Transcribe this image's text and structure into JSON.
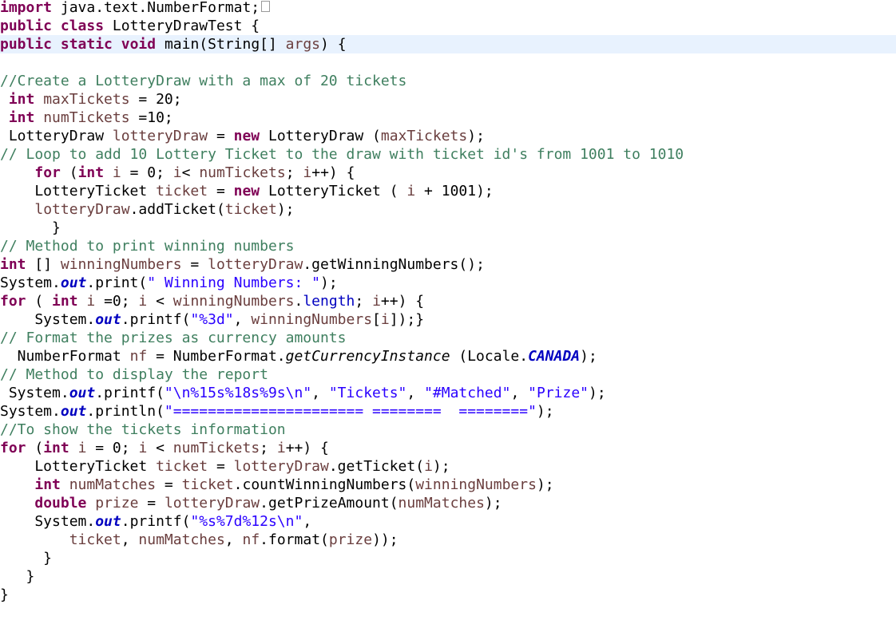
{
  "editor": {
    "current_line": 3,
    "colors": {
      "keyword": "#7f0055",
      "comment": "#3f7f5f",
      "string": "#2a00ff",
      "local_variable": "#6a3e3e",
      "static_field": "#0000c0",
      "current_line_bg": "#e8f2fe"
    },
    "lines": [
      [
        [
          "import",
          "k"
        ],
        [
          " java.text.NumberFormat;",
          "t"
        ],
        [
          "",
          "fold"
        ]
      ],
      [
        [
          "public",
          "k"
        ],
        [
          " ",
          "t"
        ],
        [
          "class",
          "k"
        ],
        [
          " LotteryDrawTest {",
          "t"
        ]
      ],
      [
        [
          "public",
          "k"
        ],
        [
          " ",
          "t"
        ],
        [
          "static",
          "k"
        ],
        [
          " ",
          "t"
        ],
        [
          "void",
          "k"
        ],
        [
          " main(String[] ",
          "t"
        ],
        [
          "args",
          "v"
        ],
        [
          ") {",
          "t"
        ]
      ],
      [],
      [
        [
          "//Create a LotteryDraw with a max of 20 tickets",
          "c"
        ]
      ],
      [
        [
          " ",
          "t"
        ],
        [
          "int",
          "k"
        ],
        [
          " ",
          "t"
        ],
        [
          "maxTickets",
          "v"
        ],
        [
          " = 20;",
          "t"
        ]
      ],
      [
        [
          " ",
          "t"
        ],
        [
          "int",
          "k"
        ],
        [
          " ",
          "t"
        ],
        [
          "numTickets",
          "v"
        ],
        [
          " =10;",
          "t"
        ]
      ],
      [
        [
          " LotteryDraw ",
          "t"
        ],
        [
          "lotteryDraw",
          "v"
        ],
        [
          " = ",
          "t"
        ],
        [
          "new",
          "k"
        ],
        [
          " LotteryDraw (",
          "t"
        ],
        [
          "maxTickets",
          "v"
        ],
        [
          ");",
          "t"
        ]
      ],
      [
        [
          "// Loop to add 10 Lottery Ticket to the draw with ticket id's from 1001 to 1010",
          "c"
        ]
      ],
      [
        [
          "    ",
          "t"
        ],
        [
          "for",
          "k"
        ],
        [
          " (",
          "t"
        ],
        [
          "int",
          "k"
        ],
        [
          " ",
          "t"
        ],
        [
          "i",
          "v"
        ],
        [
          " = 0; ",
          "t"
        ],
        [
          "i",
          "v"
        ],
        [
          "< ",
          "t"
        ],
        [
          "numTickets",
          "v"
        ],
        [
          "; ",
          "t"
        ],
        [
          "i",
          "v"
        ],
        [
          "++) {",
          "t"
        ]
      ],
      [
        [
          "    LotteryTicket ",
          "t"
        ],
        [
          "ticket",
          "v"
        ],
        [
          " = ",
          "t"
        ],
        [
          "new",
          "k"
        ],
        [
          " LotteryTicket ( ",
          "t"
        ],
        [
          "i",
          "v"
        ],
        [
          " + 1001);",
          "t"
        ]
      ],
      [
        [
          "    ",
          "t"
        ],
        [
          "lotteryDraw",
          "v"
        ],
        [
          ".addTicket(",
          "t"
        ],
        [
          "ticket",
          "v"
        ],
        [
          ");",
          "t"
        ]
      ],
      [
        [
          "      }",
          "t"
        ]
      ],
      [
        [
          "// Method to print winning numbers",
          "c"
        ]
      ],
      [
        [
          "int",
          "k"
        ],
        [
          " [] ",
          "t"
        ],
        [
          "winningNumbers",
          "v"
        ],
        [
          " = ",
          "t"
        ],
        [
          "lotteryDraw",
          "v"
        ],
        [
          ".getWinningNumbers();",
          "t"
        ]
      ],
      [
        [
          "System.",
          "t"
        ],
        [
          "out",
          "f"
        ],
        [
          ".print(",
          "t"
        ],
        [
          "\" Winning Numbers: \"",
          "s"
        ],
        [
          ");",
          "t"
        ]
      ],
      [
        [
          "for",
          "k"
        ],
        [
          " ( ",
          "t"
        ],
        [
          "int",
          "k"
        ],
        [
          " ",
          "t"
        ],
        [
          "i",
          "v"
        ],
        [
          " =0; ",
          "t"
        ],
        [
          "i",
          "v"
        ],
        [
          " < ",
          "t"
        ],
        [
          "winningNumbers",
          "v"
        ],
        [
          ".",
          "t"
        ],
        [
          "length",
          "p"
        ],
        [
          "; ",
          "t"
        ],
        [
          "i",
          "v"
        ],
        [
          "++) {",
          "t"
        ]
      ],
      [
        [
          "    System.",
          "t"
        ],
        [
          "out",
          "f"
        ],
        [
          ".printf(",
          "t"
        ],
        [
          "\"%3d\"",
          "s"
        ],
        [
          ", ",
          "t"
        ],
        [
          "winningNumbers",
          "v"
        ],
        [
          "[",
          "t"
        ],
        [
          "i",
          "v"
        ],
        [
          "]);}",
          "t"
        ]
      ],
      [
        [
          "// Format the prizes as currency amounts",
          "c"
        ]
      ],
      [
        [
          "  NumberFormat ",
          "t"
        ],
        [
          "nf",
          "v"
        ],
        [
          " = NumberFormat.",
          "t"
        ],
        [
          "getCurrencyInstance",
          "m"
        ],
        [
          " (Locale.",
          "t"
        ],
        [
          "CANADA",
          "f"
        ],
        [
          ");",
          "t"
        ]
      ],
      [
        [
          "// Method to display the report",
          "c"
        ]
      ],
      [
        [
          " System.",
          "t"
        ],
        [
          "out",
          "f"
        ],
        [
          ".printf(",
          "t"
        ],
        [
          "\"\\n%15s%18s%9s\\n\"",
          "s"
        ],
        [
          ", ",
          "t"
        ],
        [
          "\"Tickets\"",
          "s"
        ],
        [
          ", ",
          "t"
        ],
        [
          "\"#Matched\"",
          "s"
        ],
        [
          ", ",
          "t"
        ],
        [
          "\"Prize\"",
          "s"
        ],
        [
          ");",
          "t"
        ]
      ],
      [
        [
          "System.",
          "t"
        ],
        [
          "out",
          "f"
        ],
        [
          ".println(",
          "t"
        ],
        [
          "\"====================== ========  ========\"",
          "s"
        ],
        [
          ");",
          "t"
        ]
      ],
      [
        [
          "//To show the tickets information",
          "c"
        ]
      ],
      [
        [
          "for",
          "k"
        ],
        [
          " (",
          "t"
        ],
        [
          "int",
          "k"
        ],
        [
          " ",
          "t"
        ],
        [
          "i",
          "v"
        ],
        [
          " = 0; ",
          "t"
        ],
        [
          "i",
          "v"
        ],
        [
          " < ",
          "t"
        ],
        [
          "numTickets",
          "v"
        ],
        [
          "; ",
          "t"
        ],
        [
          "i",
          "v"
        ],
        [
          "++) {",
          "t"
        ]
      ],
      [
        [
          "    LotteryTicket ",
          "t"
        ],
        [
          "ticket",
          "v"
        ],
        [
          " = ",
          "t"
        ],
        [
          "lotteryDraw",
          "v"
        ],
        [
          ".getTicket(",
          "t"
        ],
        [
          "i",
          "v"
        ],
        [
          ");",
          "t"
        ]
      ],
      [
        [
          "    ",
          "t"
        ],
        [
          "int",
          "k"
        ],
        [
          " ",
          "t"
        ],
        [
          "numMatches",
          "v"
        ],
        [
          " = ",
          "t"
        ],
        [
          "ticket",
          "v"
        ],
        [
          ".countWinningNumbers(",
          "t"
        ],
        [
          "winningNumbers",
          "v"
        ],
        [
          ");",
          "t"
        ]
      ],
      [
        [
          "    ",
          "t"
        ],
        [
          "double",
          "k"
        ],
        [
          " ",
          "t"
        ],
        [
          "prize",
          "v"
        ],
        [
          " = ",
          "t"
        ],
        [
          "lotteryDraw",
          "v"
        ],
        [
          ".getPrizeAmount(",
          "t"
        ],
        [
          "numMatches",
          "v"
        ],
        [
          ");",
          "t"
        ]
      ],
      [
        [
          "    System.",
          "t"
        ],
        [
          "out",
          "f"
        ],
        [
          ".printf(",
          "t"
        ],
        [
          "\"%s%7d%12s\\n\"",
          "s"
        ],
        [
          ",",
          "t"
        ]
      ],
      [
        [
          "        ",
          "t"
        ],
        [
          "ticket",
          "v"
        ],
        [
          ", ",
          "t"
        ],
        [
          "numMatches",
          "v"
        ],
        [
          ", ",
          "t"
        ],
        [
          "nf",
          "v"
        ],
        [
          ".format(",
          "t"
        ],
        [
          "prize",
          "v"
        ],
        [
          "));",
          "t"
        ]
      ],
      [
        [
          "     }",
          "t"
        ]
      ],
      [
        [
          "   }",
          "t"
        ]
      ],
      [
        [
          "}",
          "t"
        ]
      ]
    ]
  }
}
